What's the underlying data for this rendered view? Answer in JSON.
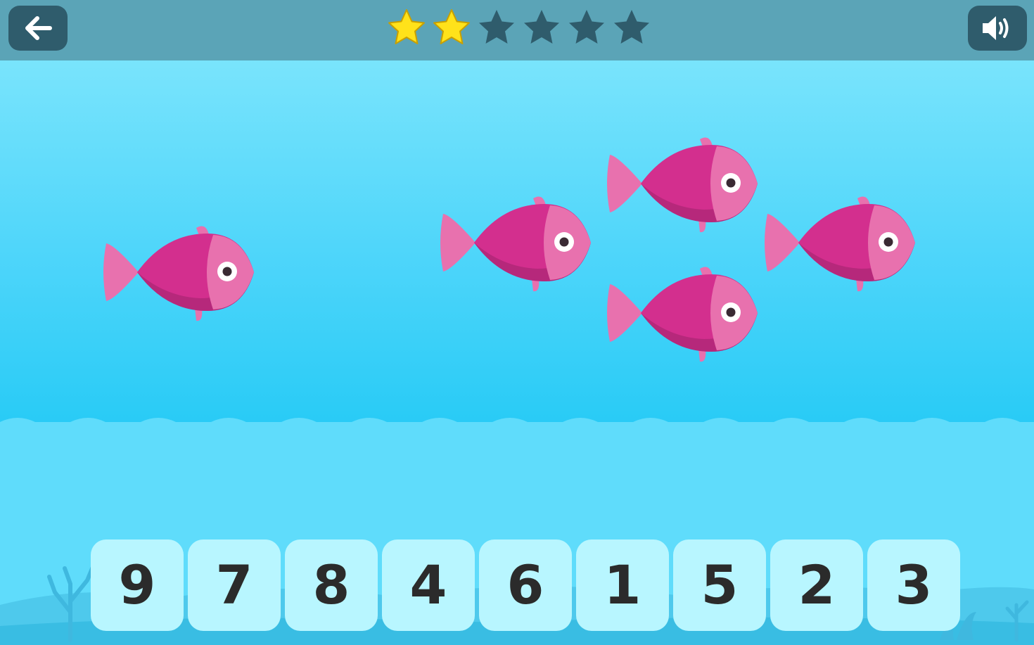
{
  "header": {
    "back_icon": "arrow-left-icon",
    "sound_icon": "speaker-icon",
    "stars": [
      {
        "state": "earned",
        "color": "#ffe21a"
      },
      {
        "state": "earned",
        "color": "#ffe21a"
      },
      {
        "state": "empty",
        "color": "#2f5c6c"
      },
      {
        "state": "empty",
        "color": "#2f5c6c"
      },
      {
        "state": "empty",
        "color": "#2f5c6c"
      },
      {
        "state": "empty",
        "color": "#2f5c6c"
      }
    ],
    "stars_earned": 2,
    "stars_total": 6
  },
  "scene": {
    "fish_count": 5,
    "fish_color": "#d32f8e",
    "fish_fin_color": "#e871ae"
  },
  "answers": {
    "options": [
      "9",
      "7",
      "8",
      "4",
      "6",
      "1",
      "5",
      "2",
      "3"
    ]
  },
  "colors": {
    "topbar": "#5ba4b7",
    "button": "#2f5c6c",
    "water_top": "#79e4fc",
    "water_bottom": "#5fdcfb",
    "tile": "#b8f6ff",
    "digit": "#2b2b2b"
  }
}
